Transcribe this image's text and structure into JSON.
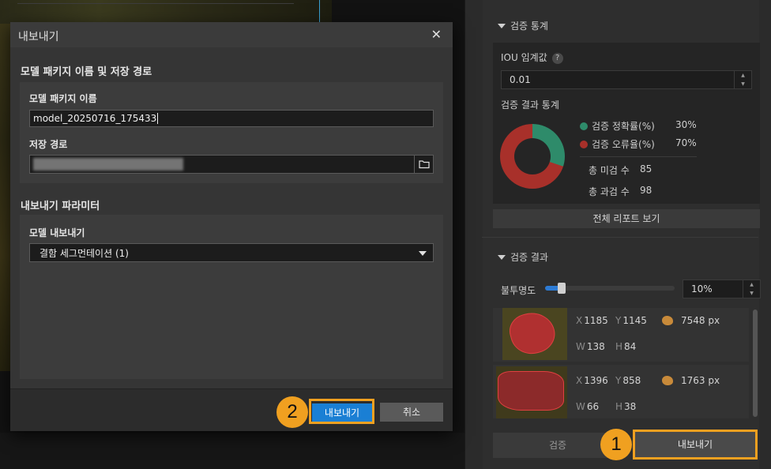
{
  "panel": {
    "stats_section_title": "검증 통계",
    "iou_label": "IOU 임계값",
    "iou_help": "?",
    "iou_value": "0.01",
    "stats_label": "검증 결과 통계",
    "legend": [
      {
        "label": "검증 정확률(%)",
        "value": "30%",
        "color": "#2e8b6a"
      },
      {
        "label": "검증 오류율(%)",
        "value": "70%",
        "color": "#a8302a"
      }
    ],
    "totals": [
      {
        "label": "총 미검 수",
        "value": "85"
      },
      {
        "label": "총 과검 수",
        "value": "98"
      }
    ],
    "full_report_button": "전체 리포트 보기",
    "results_section_title": "검증 결과",
    "opacity_label": "불투명도",
    "opacity_value": "10%",
    "opacity_level": 0.1,
    "results": [
      {
        "x_key": "X",
        "x": "1185",
        "y_key": "Y",
        "y": "1145",
        "area": "7548 px",
        "w_key": "W",
        "w": "138",
        "h_key": "H",
        "h": "84"
      },
      {
        "x_key": "X",
        "x": "1396",
        "y_key": "Y",
        "y": "858",
        "area": "1763 px",
        "w_key": "W",
        "w": "66",
        "h_key": "H",
        "h": "38"
      }
    ],
    "validate_button": "검증",
    "export_button": "내보내기"
  },
  "dialog": {
    "title": "내보내기",
    "close": "✕",
    "section1_title": "모델 패키지 이름 및 저장 경로",
    "package_name_label": "모델 패키지 이름",
    "package_name_value": "model_20250716_175433",
    "save_path_label": "저장 경로",
    "section2_title": "내보내기 파라미터",
    "model_export_label": "모델 내보내기",
    "model_export_value": "결함 세그먼테이션 (1)",
    "export_button": "내보내기",
    "cancel_button": "취소"
  },
  "annotations": {
    "badge1": "1",
    "badge2": "2",
    "highlight_color": "#f0a020"
  }
}
